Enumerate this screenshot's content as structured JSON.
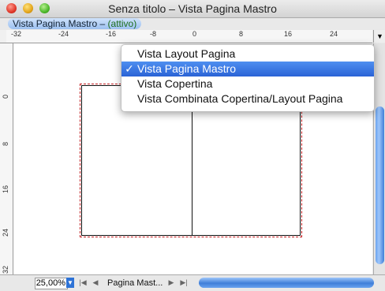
{
  "window": {
    "title": "Senza titolo – Vista Pagina Mastro"
  },
  "tab": {
    "label": "Vista Pagina Mastro –",
    "status": "(attivo)"
  },
  "ruler": {
    "h_ticks": [
      "-32",
      "-24",
      "-16",
      "-8",
      "0",
      "8",
      "16",
      "24"
    ],
    "v_ticks": [
      "0",
      "8",
      "16",
      "24",
      "32"
    ]
  },
  "menu": {
    "items": [
      {
        "label": "Vista Layout Pagina",
        "selected": false
      },
      {
        "label": "Vista Pagina Mastro",
        "selected": true
      },
      {
        "label": "Vista Copertina",
        "selected": false
      },
      {
        "label": "Vista Combinata Copertina/Layout Pagina",
        "selected": false
      }
    ],
    "check": "✓"
  },
  "bottom": {
    "zoom": "25,00%",
    "page_label": "Pagina Mast..."
  },
  "colors": {
    "accent": "#2a63d6",
    "page_bleed": "#c2181b"
  }
}
